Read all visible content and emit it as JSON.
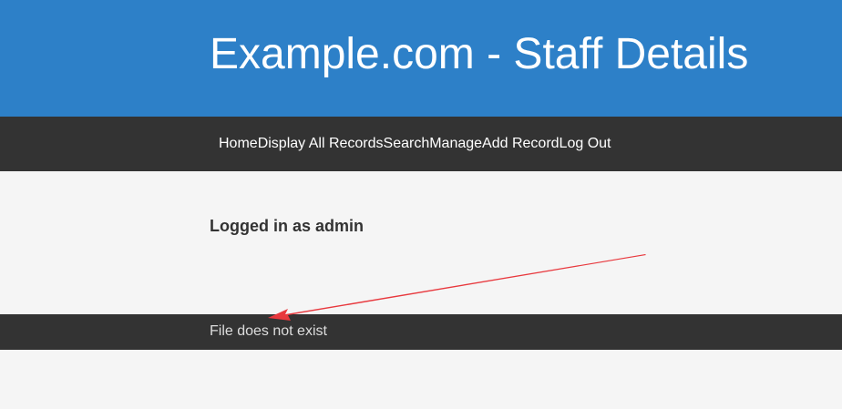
{
  "header": {
    "title": "Example.com - Staff Details",
    "background_color": "#2d80c8"
  },
  "nav": {
    "background_color": "#333333",
    "items": [
      {
        "label": "Home"
      },
      {
        "label": "Display All Records"
      },
      {
        "label": "Search"
      },
      {
        "label": "Manage"
      },
      {
        "label": "Add Record"
      },
      {
        "label": "Log Out"
      }
    ]
  },
  "main": {
    "login_status": "Logged in as admin"
  },
  "footer": {
    "message": "File does not exist"
  },
  "annotation": {
    "type": "arrow",
    "color": "#e8383d",
    "points_to": "footer.message"
  }
}
